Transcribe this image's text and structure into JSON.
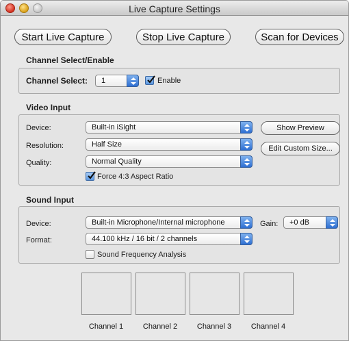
{
  "window": {
    "title": "Live Capture Settings"
  },
  "toolbar": {
    "start_label": "Start Live Capture",
    "stop_label": "Stop Live Capture",
    "scan_label": "Scan for Devices"
  },
  "channel": {
    "section_title": "Channel Select/Enable",
    "select_label": "Channel Select:",
    "select_value": "1",
    "enable_label": "Enable",
    "enable_checked": true
  },
  "video": {
    "section_title": "Video Input",
    "device_label": "Device:",
    "device_value": "Built-in iSight",
    "resolution_label": "Resolution:",
    "resolution_value": "Half Size",
    "quality_label": "Quality:",
    "quality_value": "Normal Quality",
    "force_label": "Force 4:3 Aspect Ratio",
    "force_checked": true,
    "show_preview_label": "Show Preview",
    "edit_custom_label": "Edit Custom Size..."
  },
  "sound": {
    "section_title": "Sound Input",
    "device_label": "Device:",
    "device_value": "Built-in Microphone/Internal microphone",
    "gain_label": "Gain:",
    "gain_value": "+0 dB",
    "format_label": "Format:",
    "format_value": "44.100 kHz / 16 bit / 2 channels",
    "analysis_label": "Sound Frequency Analysis",
    "analysis_checked": false
  },
  "channels": [
    "Channel 1",
    "Channel 2",
    "Channel 3",
    "Channel 4"
  ],
  "icons": {
    "close": "close-icon",
    "minimize": "minimize-icon",
    "zoom": "zoom-icon",
    "popup_arrows": "up-down-arrows-icon",
    "checkmark": "checkmark-icon"
  },
  "colors": {
    "accent": "#3f7fd8",
    "close": "#d2301f",
    "minimize": "#d9a018",
    "window_bg": "#e8e8e8"
  }
}
